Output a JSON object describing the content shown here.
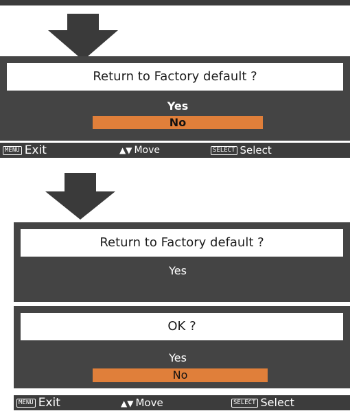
{
  "dialog1": {
    "message": "Return to Factory default ?",
    "options": [
      "Yes",
      "No"
    ],
    "selected": "No"
  },
  "help_bar": {
    "exit_key": "MENU",
    "exit_label": "Exit",
    "move_icon": "up-down-arrow-icon",
    "move_label": "Move",
    "select_key": "SELECT",
    "select_label": "Select"
  },
  "dialog2": {
    "message": "Return to Factory default ?",
    "option": "Yes"
  },
  "dialog3": {
    "message": "OK ?",
    "options": [
      "Yes",
      "No"
    ],
    "selected": "No"
  },
  "colors": {
    "panel": "#444444",
    "highlight": "#e07f3a",
    "arrow": "#3a3a3a"
  }
}
